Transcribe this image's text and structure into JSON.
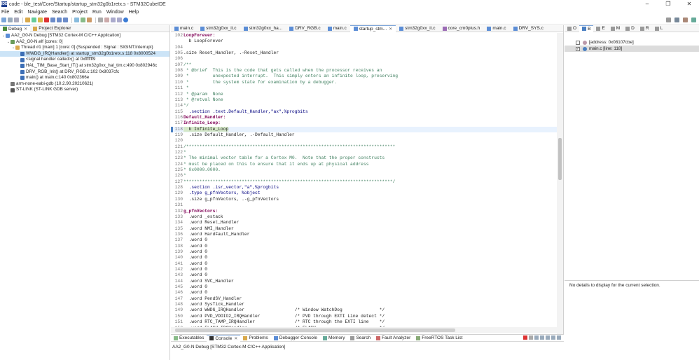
{
  "window": {
    "title": "code - ble_test/Core/Startup/startup_stm32g0b1retx.s - STM32CubeIDE",
    "app_icon": "IDE"
  },
  "menu": [
    "File",
    "Edit",
    "Navigate",
    "Search",
    "Project",
    "Run",
    "Window",
    "Help"
  ],
  "debug_view": {
    "tabs": [
      {
        "label": "Debug",
        "active": true
      },
      {
        "label": "Project Explorer",
        "active": false
      }
    ],
    "tree": [
      {
        "indent": 0,
        "label": "AA2_G0-N Debug [STM32 Cortex-M C/C++ Application]",
        "icon": "launch-icon",
        "twisty": "v",
        "selected": false
      },
      {
        "indent": 1,
        "label": "AA2_G0-N.elf [cores: 0]",
        "icon": "elf-icon",
        "twisty": "v",
        "selected": false
      },
      {
        "indent": 2,
        "label": "Thread #1 [main] 1 [core: 0] (Suspended : Signal : SIGINT:Interrupt)",
        "icon": "thread-icon",
        "twisty": "v",
        "selected": false
      },
      {
        "indent": 3,
        "label": "WWDG_IRQHandler() at startup_stm32g0b1retx.s:118 0x8000524",
        "icon": "frame-icon",
        "twisty": "",
        "selected": true
      },
      {
        "indent": 3,
        "label": "<signal handler called>() at 0xfffffff9",
        "icon": "frame-icon",
        "twisty": "",
        "selected": false
      },
      {
        "indent": 3,
        "label": "HAL_TIM_Base_Start_IT() at stm32g0xx_hal_tim.c:490 0x802946c",
        "icon": "frame-icon",
        "twisty": "",
        "selected": false
      },
      {
        "indent": 3,
        "label": "DRV_RGB_Init() at DRV_RGB.c:102 0x8037cfc",
        "icon": "frame-icon",
        "twisty": "",
        "selected": false
      },
      {
        "indent": 3,
        "label": "main() at main.c:140 0x802366e",
        "icon": "frame-icon",
        "twisty": "",
        "selected": false
      },
      {
        "indent": 1,
        "label": "arm-none-eabi-gdb (10.2.90.20210621)",
        "icon": "gdb-icon",
        "twisty": "",
        "selected": false
      },
      {
        "indent": 1,
        "label": "ST-LINK (ST-LINK GDB server)",
        "icon": "stlink-icon",
        "twisty": "",
        "selected": false
      }
    ]
  },
  "editor": {
    "tabs": [
      "main.c",
      "stm32g0xx_it.c",
      "stm32g0xx_ha...",
      "DRV_RGB.c",
      "main.c",
      "startup_stm...",
      "stm32g0xx_it.c",
      "core_cm0plus.h",
      "main.c",
      "DRV_SYS.c"
    ],
    "active_tab": 5,
    "current_line": 118,
    "lines": [
      {
        "n": "102",
        "t": "LoopForever:",
        "k": "lab"
      },
      {
        "n": "",
        "t": "  b LoopForever",
        "k": "plain"
      },
      {
        "n": "104",
        "t": "",
        "k": "plain"
      },
      {
        "n": "105",
        "t": ".size Reset_Handler, .-Reset_Handler",
        "k": "plain"
      },
      {
        "n": "106",
        "t": "",
        "k": "plain"
      },
      {
        "n": "107",
        "t": "/**",
        "k": "cm"
      },
      {
        "n": "108",
        "t": " * @brief  This is the code that gets called when the processor receives an",
        "k": "cm"
      },
      {
        "n": "109",
        "t": " *         unexpected interrupt.  This simply enters an infinite loop, preserving",
        "k": "cm"
      },
      {
        "n": "110",
        "t": " *         the system state for examination by a debugger.",
        "k": "cm"
      },
      {
        "n": "111",
        "t": " *",
        "k": "cm"
      },
      {
        "n": "112",
        "t": " * @param  None",
        "k": "cm"
      },
      {
        "n": "113",
        "t": " * @retval None",
        "k": "cm"
      },
      {
        "n": "114",
        "t": "*/",
        "k": "cm"
      },
      {
        "n": "115",
        "t": "  .section .text.Default_Handler,\"ax\",%progbits",
        "k": "dir"
      },
      {
        "n": "116",
        "t": "Default_Handler:",
        "k": "lab"
      },
      {
        "n": "117",
        "t": "Infinite_Loop:",
        "k": "lab"
      },
      {
        "n": "118",
        "t": "  b Infinite_Loop",
        "k": "cur"
      },
      {
        "n": "119",
        "t": "  .size Default_Handler, .-Default_Handler",
        "k": "plain"
      },
      {
        "n": "120",
        "t": "",
        "k": "plain"
      },
      {
        "n": "121",
        "t": "/*******************************************************************************",
        "k": "cm"
      },
      {
        "n": "122",
        "t": "*",
        "k": "cm"
      },
      {
        "n": "123",
        "t": "* The minimal vector table for a Cortex M0.  Note that the proper constructs",
        "k": "cm"
      },
      {
        "n": "124",
        "t": "* must be placed on this to ensure that it ends up at physical address",
        "k": "cm"
      },
      {
        "n": "125",
        "t": "* 0x0000.0000.",
        "k": "cm"
      },
      {
        "n": "126",
        "t": "*",
        "k": "cm"
      },
      {
        "n": "127",
        "t": "*******************************************************************************/",
        "k": "cm"
      },
      {
        "n": "128",
        "t": "  .section .isr_vector,\"a\",%progbits",
        "k": "dir"
      },
      {
        "n": "129",
        "t": "  .type g_pfnVectors, %object",
        "k": "dir"
      },
      {
        "n": "130",
        "t": "  .size g_pfnVectors, .-g_pfnVectors",
        "k": "plain"
      },
      {
        "n": "131",
        "t": "",
        "k": "plain"
      },
      {
        "n": "132",
        "t": "g_pfnVectors:",
        "k": "lab"
      },
      {
        "n": "133",
        "t": "  .word _estack",
        "k": "word"
      },
      {
        "n": "134",
        "t": "  .word Reset_Handler",
        "k": "word"
      },
      {
        "n": "135",
        "t": "  .word NMI_Handler",
        "k": "word"
      },
      {
        "n": "136",
        "t": "  .word HardFault_Handler",
        "k": "word"
      },
      {
        "n": "137",
        "t": "  .word 0",
        "k": "word"
      },
      {
        "n": "138",
        "t": "  .word 0",
        "k": "word"
      },
      {
        "n": "139",
        "t": "  .word 0",
        "k": "word"
      },
      {
        "n": "140",
        "t": "  .word 0",
        "k": "word"
      },
      {
        "n": "141",
        "t": "  .word 0",
        "k": "word"
      },
      {
        "n": "142",
        "t": "  .word 0",
        "k": "word"
      },
      {
        "n": "143",
        "t": "  .word 0",
        "k": "word"
      },
      {
        "n": "144",
        "t": "  .word SVC_Handler",
        "k": "word"
      },
      {
        "n": "145",
        "t": "  .word 0",
        "k": "word"
      },
      {
        "n": "146",
        "t": "  .word 0",
        "k": "word"
      },
      {
        "n": "147",
        "t": "  .word PendSV_Handler",
        "k": "word"
      },
      {
        "n": "148",
        "t": "  .word SysTick_Handler",
        "k": "word"
      },
      {
        "n": "149",
        "t": "  .word WWDG_IRQHandler                   /* Window WatchDog              */",
        "k": "wordc"
      },
      {
        "n": "150",
        "t": "  .word PVD_VDDIO2_IRQHandler             /* PVD through EXTI Line detect */",
        "k": "wordc"
      },
      {
        "n": "151",
        "t": "  .word RTC_TAMP_IRQHandler               /* RTC through the EXTI line    */",
        "k": "wordc"
      },
      {
        "n": "152",
        "t": "  .word FLASH_IRQHandler                  /* FLASH                        */",
        "k": "wordc"
      }
    ]
  },
  "right_view": {
    "tab_icons": [
      "o-icon",
      "breakpoint-icon",
      "e-icon",
      "m-icon",
      "d-icon",
      "r-icon",
      "l-icon"
    ],
    "expressions": [
      {
        "label": "[address: 0x08107cbe]",
        "checked": false,
        "selected": false
      },
      {
        "label": "main.c [line: 118]",
        "checked": true,
        "selected": true
      }
    ],
    "details": "No details to display for the current selection."
  },
  "console_view": {
    "tabs": [
      "Executables",
      "Console",
      "Problems",
      "Debugger Console",
      "Memory",
      "Search",
      "Fault Analyzer",
      "FreeRTOS Task List"
    ],
    "active_tab": 1,
    "text": "AA2_G0-N Debug [STM32 Cortex-M C/C++ Application]"
  }
}
